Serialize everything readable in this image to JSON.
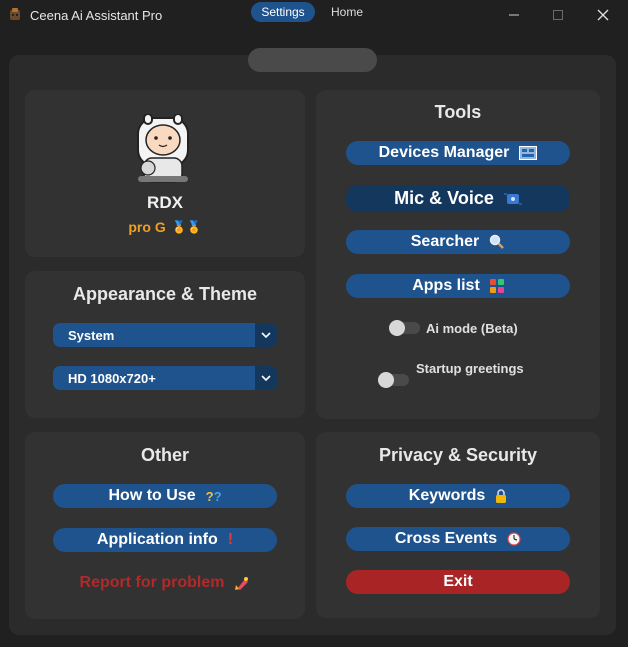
{
  "window": {
    "title": "Ceena Ai Assistant Pro",
    "minimize_icon": "minimize-icon",
    "maximize_icon": "maximize-icon",
    "close_icon": "close-icon"
  },
  "tabs": [
    {
      "label": "Settings",
      "active": true
    },
    {
      "label": "Home",
      "active": false
    }
  ],
  "profile": {
    "name": "RDX",
    "subtitle": "pro G",
    "badges": "🏅🏅",
    "avatar_icon": "cartoon-character-avatar"
  },
  "appearance": {
    "heading": "Appearance & Theme",
    "theme_value": "System",
    "resolution_value": "HD 1080x720+"
  },
  "tools": {
    "heading": "Tools",
    "buttons": [
      {
        "label": "Devices Manager",
        "icon": "🗂️"
      },
      {
        "label": "Mic & Voice",
        "icon": "🎙️"
      },
      {
        "label": "Searcher",
        "icon": "🔍"
      },
      {
        "label": "Apps list",
        "icon": "▪️"
      }
    ],
    "switches": [
      {
        "label": "Ai mode (Beta)",
        "on": false
      },
      {
        "label": "Startup greetings",
        "on": false
      }
    ]
  },
  "other": {
    "heading": "Other",
    "how_to_use": "How to Use",
    "how_to_use_icon": "❔",
    "app_info": "Application info",
    "app_info_icon": "❗",
    "report": "Report for problem",
    "report_icon": "🧯"
  },
  "privacy": {
    "heading": "Privacy & Security",
    "keywords": "Keywords",
    "keywords_icon": "🔒",
    "cross_events": "Cross Events",
    "cross_events_icon": "🕒",
    "exit": "Exit"
  },
  "colors": {
    "accent": "#1f538d",
    "accent_dark": "#14375e",
    "danger": "#a92525",
    "gold": "#f0a020",
    "report_text": "#b02a2a"
  }
}
